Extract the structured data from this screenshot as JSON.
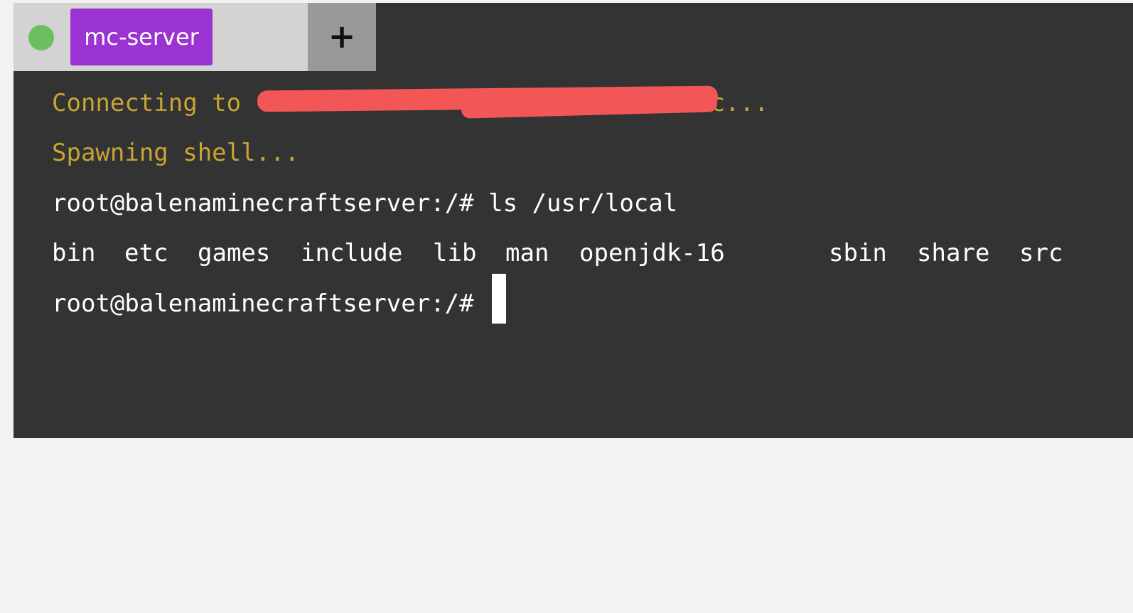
{
  "tab": {
    "status_icon": "status-dot-icon",
    "status_color": "#6cbf5f",
    "label": "mc-server",
    "label_color": "#9b32d2"
  },
  "new_tab": {
    "label": "+"
  },
  "terminal": {
    "line1_prefix": "Connecting to ",
    "line1_suffix": "c...",
    "line2": "Spawning shell...",
    "prompt": "root@balenaminecraftserver:/#",
    "command": "ls /usr/local",
    "listing": [
      "bin",
      "etc",
      "games",
      "include",
      "lib",
      "man",
      "openjdk-16",
      "sbin",
      "share",
      "src"
    ],
    "prompt2": "root@balenaminecraftserver:/#"
  }
}
